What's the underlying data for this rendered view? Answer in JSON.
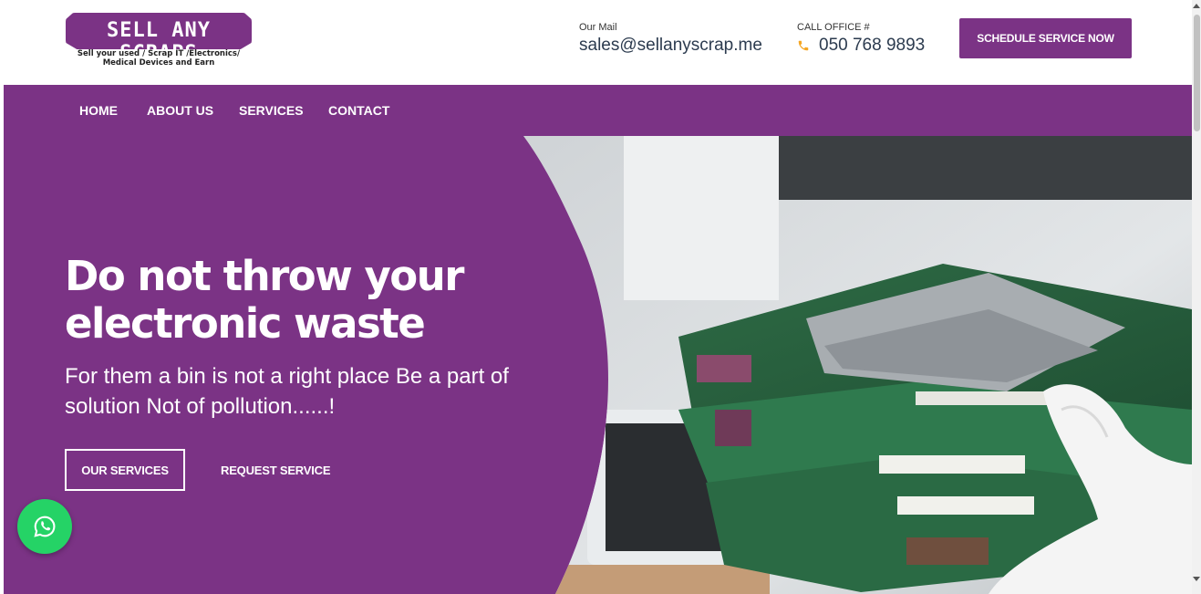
{
  "logo": {
    "text": "SELL ANY SCRAPS",
    "tagline_line1": "Sell your used / Scrap IT /Electronics/",
    "tagline_line2": "Medical Devices and Earn"
  },
  "contact": {
    "mail_label": "Our Mail",
    "mail_value": "sales@sellanyscrap.me",
    "call_label": "CALL OFFICE #",
    "call_value": "050 768 9893"
  },
  "header": {
    "schedule_label": "SCHEDULE SERVICE NOW"
  },
  "nav": {
    "items": [
      {
        "label": "HOME"
      },
      {
        "label": "ABOUT US"
      },
      {
        "label": "SERVICES"
      },
      {
        "label": "CONTACT"
      }
    ]
  },
  "hero": {
    "title": "Do not throw your electronic waste",
    "subtitle": "For them a bin is not a right place Be a part of solution Not of pollution......!",
    "primary_button": "OUR SERVICES",
    "secondary_button": "REQUEST SERVICE"
  },
  "icons": {
    "phone": "phone-icon",
    "whatsapp": "whatsapp-icon"
  },
  "colors": {
    "brand_purple": "#7b3385",
    "accent_orange": "#f5a623",
    "whatsapp_green": "#25d366"
  }
}
